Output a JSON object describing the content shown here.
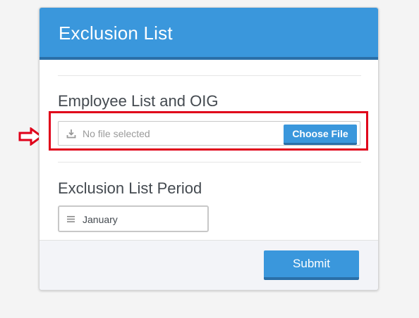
{
  "card": {
    "title": "Exclusion List"
  },
  "employee_section": {
    "label": "Employee List and OIG",
    "file_placeholder": "No file selected",
    "choose_button": "Choose File"
  },
  "period_section": {
    "label": "Exclusion List Period",
    "selected_value": "January"
  },
  "footer": {
    "submit_label": "Submit"
  },
  "icons": {
    "download": "download-icon",
    "menu": "menu-lines-icon",
    "arrow": "right-arrow-icon"
  },
  "colors": {
    "accent": "#3a97dc",
    "accent_dark": "#2a6fa8",
    "highlight": "#e0001a"
  }
}
